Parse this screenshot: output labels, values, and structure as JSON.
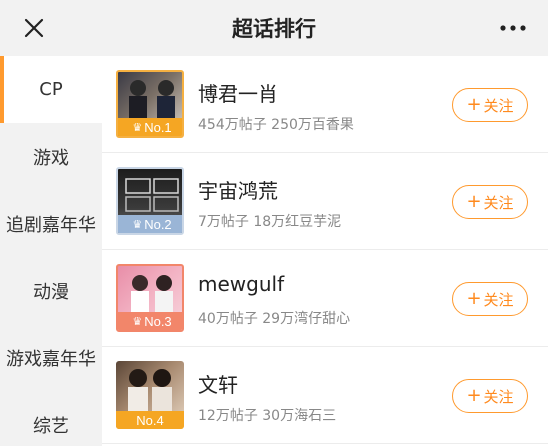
{
  "header": {
    "title": "超话排行",
    "close_icon": "close-icon",
    "more_icon": "more-icon"
  },
  "sidebar": {
    "items": [
      {
        "label": "CP",
        "active": true
      },
      {
        "label": "游戏",
        "active": false
      },
      {
        "label": "追剧嘉年华",
        "active": false
      },
      {
        "label": "动漫",
        "active": false
      },
      {
        "label": "游戏嘉年华",
        "active": false
      },
      {
        "label": "综艺",
        "active": false
      }
    ]
  },
  "ranking": {
    "follow_label": "关注",
    "items": [
      {
        "rank": "No.1",
        "name": "博君一肖",
        "stats": "454万帖子 250万百香果",
        "badge_color": "#f5a623",
        "crown": true
      },
      {
        "rank": "No.2",
        "name": "宇宙鸿荒",
        "stats": "7万帖子 18万红豆芋泥",
        "badge_color": "#9ab5d6",
        "crown": true
      },
      {
        "rank": "No.3",
        "name": "mewgulf",
        "stats": "40万帖子 29万湾仔甜心",
        "badge_color": "#f2866a",
        "crown": true
      },
      {
        "rank": "No.4",
        "name": "文轩",
        "stats": "12万帖子 30万海石三",
        "badge_color": "#f5a623",
        "crown": false
      }
    ]
  },
  "colors": {
    "accent": "#ff9a2e",
    "text_secondary": "#888888"
  }
}
